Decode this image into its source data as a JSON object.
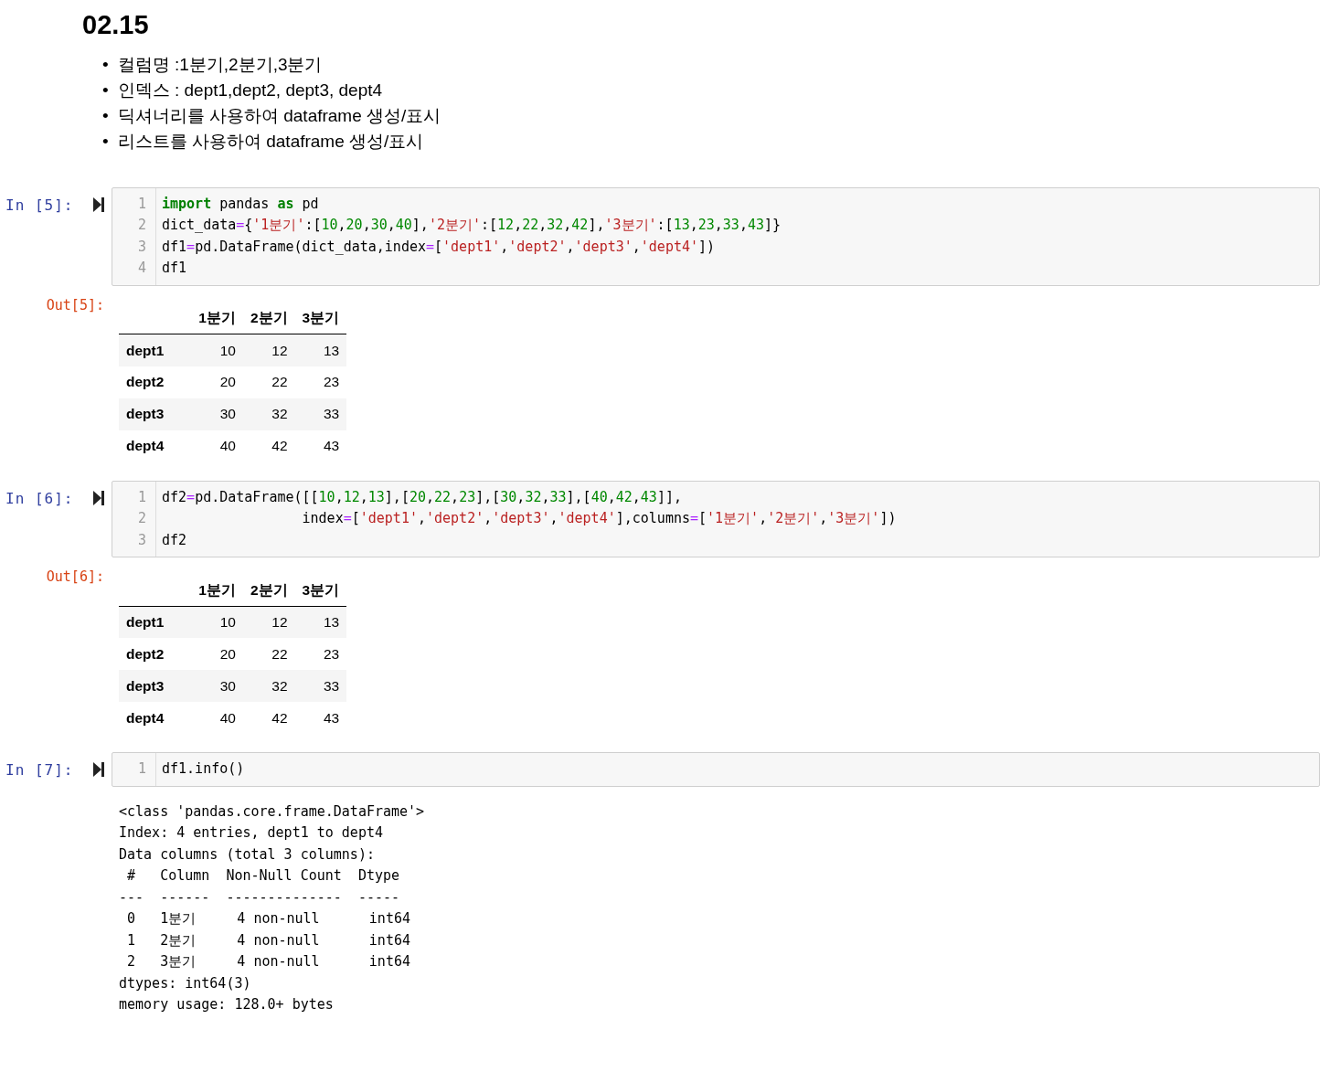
{
  "markdown": {
    "heading": "02.15",
    "bullets": [
      {
        "marker": "•",
        "text": "컬럼명 :1분기,2분기,3분기"
      },
      {
        "marker": "•",
        "text": "인덱스 : dept1,dept2, dept3, dept4"
      },
      {
        "marker": "•",
        "text": "딕셔너리를 사용하여 dataframe 생성/표시"
      },
      {
        "marker": "•",
        "text": "리스트를 사용하여 dataframe 생성/표시"
      }
    ]
  },
  "cells": [
    {
      "prompt": "In [5]:",
      "line_numbers": [
        "1",
        "2",
        "3",
        "4"
      ],
      "lines": [
        [
          {
            "kind": "kw",
            "text": "import"
          },
          {
            "kind": "plain",
            "text": " pandas "
          },
          {
            "kind": "kw",
            "text": "as"
          },
          {
            "kind": "plain",
            "text": " pd"
          }
        ],
        [
          {
            "kind": "plain",
            "text": "dict_data"
          },
          {
            "kind": "op",
            "text": "="
          },
          {
            "kind": "plain",
            "text": "{"
          },
          {
            "kind": "str",
            "text": "'1분기'"
          },
          {
            "kind": "plain",
            "text": ":["
          },
          {
            "kind": "num",
            "text": "10"
          },
          {
            "kind": "plain",
            "text": ","
          },
          {
            "kind": "num",
            "text": "20"
          },
          {
            "kind": "plain",
            "text": ","
          },
          {
            "kind": "num",
            "text": "30"
          },
          {
            "kind": "plain",
            "text": ","
          },
          {
            "kind": "num",
            "text": "40"
          },
          {
            "kind": "plain",
            "text": "],"
          },
          {
            "kind": "str",
            "text": "'2분기'"
          },
          {
            "kind": "plain",
            "text": ":["
          },
          {
            "kind": "num",
            "text": "12"
          },
          {
            "kind": "plain",
            "text": ","
          },
          {
            "kind": "num",
            "text": "22"
          },
          {
            "kind": "plain",
            "text": ","
          },
          {
            "kind": "num",
            "text": "32"
          },
          {
            "kind": "plain",
            "text": ","
          },
          {
            "kind": "num",
            "text": "42"
          },
          {
            "kind": "plain",
            "text": "],"
          },
          {
            "kind": "str",
            "text": "'3분기'"
          },
          {
            "kind": "plain",
            "text": ":["
          },
          {
            "kind": "num",
            "text": "13"
          },
          {
            "kind": "plain",
            "text": ","
          },
          {
            "kind": "num",
            "text": "23"
          },
          {
            "kind": "plain",
            "text": ","
          },
          {
            "kind": "num",
            "text": "33"
          },
          {
            "kind": "plain",
            "text": ","
          },
          {
            "kind": "num",
            "text": "43"
          },
          {
            "kind": "plain",
            "text": "]}"
          }
        ],
        [
          {
            "kind": "plain",
            "text": "df1"
          },
          {
            "kind": "op",
            "text": "="
          },
          {
            "kind": "plain",
            "text": "pd.DataFrame(dict_data,index"
          },
          {
            "kind": "op",
            "text": "="
          },
          {
            "kind": "plain",
            "text": "["
          },
          {
            "kind": "str",
            "text": "'dept1'"
          },
          {
            "kind": "plain",
            "text": ","
          },
          {
            "kind": "str",
            "text": "'dept2'"
          },
          {
            "kind": "plain",
            "text": ","
          },
          {
            "kind": "str",
            "text": "'dept3'"
          },
          {
            "kind": "plain",
            "text": ","
          },
          {
            "kind": "str",
            "text": "'dept4'"
          },
          {
            "kind": "plain",
            "text": "])"
          }
        ],
        [
          {
            "kind": "plain",
            "text": "df1"
          }
        ]
      ],
      "output": {
        "prompt": "Out[5]:",
        "kind": "table",
        "columns": [
          "1분기",
          "2분기",
          "3분기"
        ],
        "rows": [
          {
            "index": "dept1",
            "values": [
              "10",
              "12",
              "13"
            ]
          },
          {
            "index": "dept2",
            "values": [
              "20",
              "22",
              "23"
            ]
          },
          {
            "index": "dept3",
            "values": [
              "30",
              "32",
              "33"
            ]
          },
          {
            "index": "dept4",
            "values": [
              "40",
              "42",
              "43"
            ]
          }
        ]
      }
    },
    {
      "prompt": "In [6]:",
      "line_numbers": [
        "1",
        "2",
        "3"
      ],
      "lines": [
        [
          {
            "kind": "plain",
            "text": "df2"
          },
          {
            "kind": "op",
            "text": "="
          },
          {
            "kind": "plain",
            "text": "pd.DataFrame([["
          },
          {
            "kind": "num",
            "text": "10"
          },
          {
            "kind": "plain",
            "text": ","
          },
          {
            "kind": "num",
            "text": "12"
          },
          {
            "kind": "plain",
            "text": ","
          },
          {
            "kind": "num",
            "text": "13"
          },
          {
            "kind": "plain",
            "text": "],["
          },
          {
            "kind": "num",
            "text": "20"
          },
          {
            "kind": "plain",
            "text": ","
          },
          {
            "kind": "num",
            "text": "22"
          },
          {
            "kind": "plain",
            "text": ","
          },
          {
            "kind": "num",
            "text": "23"
          },
          {
            "kind": "plain",
            "text": "],["
          },
          {
            "kind": "num",
            "text": "30"
          },
          {
            "kind": "plain",
            "text": ","
          },
          {
            "kind": "num",
            "text": "32"
          },
          {
            "kind": "plain",
            "text": ","
          },
          {
            "kind": "num",
            "text": "33"
          },
          {
            "kind": "plain",
            "text": "],["
          },
          {
            "kind": "num",
            "text": "40"
          },
          {
            "kind": "plain",
            "text": ","
          },
          {
            "kind": "num",
            "text": "42"
          },
          {
            "kind": "plain",
            "text": ","
          },
          {
            "kind": "num",
            "text": "43"
          },
          {
            "kind": "plain",
            "text": "]],"
          }
        ],
        [
          {
            "kind": "plain",
            "text": "                 index"
          },
          {
            "kind": "op",
            "text": "="
          },
          {
            "kind": "plain",
            "text": "["
          },
          {
            "kind": "str",
            "text": "'dept1'"
          },
          {
            "kind": "plain",
            "text": ","
          },
          {
            "kind": "str",
            "text": "'dept2'"
          },
          {
            "kind": "plain",
            "text": ","
          },
          {
            "kind": "str",
            "text": "'dept3'"
          },
          {
            "kind": "plain",
            "text": ","
          },
          {
            "kind": "str",
            "text": "'dept4'"
          },
          {
            "kind": "plain",
            "text": "],columns"
          },
          {
            "kind": "op",
            "text": "="
          },
          {
            "kind": "plain",
            "text": "["
          },
          {
            "kind": "str",
            "text": "'1분기'"
          },
          {
            "kind": "plain",
            "text": ","
          },
          {
            "kind": "str",
            "text": "'2분기'"
          },
          {
            "kind": "plain",
            "text": ","
          },
          {
            "kind": "str",
            "text": "'3분기'"
          },
          {
            "kind": "plain",
            "text": "])"
          }
        ],
        [
          {
            "kind": "plain",
            "text": "df2"
          }
        ]
      ],
      "output": {
        "prompt": "Out[6]:",
        "kind": "table",
        "columns": [
          "1분기",
          "2분기",
          "3분기"
        ],
        "rows": [
          {
            "index": "dept1",
            "values": [
              "10",
              "12",
              "13"
            ]
          },
          {
            "index": "dept2",
            "values": [
              "20",
              "22",
              "23"
            ]
          },
          {
            "index": "dept3",
            "values": [
              "30",
              "32",
              "33"
            ]
          },
          {
            "index": "dept4",
            "values": [
              "40",
              "42",
              "43"
            ]
          }
        ]
      }
    },
    {
      "prompt": "In [7]:",
      "line_numbers": [
        "1"
      ],
      "lines": [
        [
          {
            "kind": "plain",
            "text": "df1.info()"
          }
        ]
      ],
      "output": {
        "kind": "stream",
        "lines": [
          "<class 'pandas.core.frame.DataFrame'>",
          "Index: 4 entries, dept1 to dept4",
          "Data columns (total 3 columns):",
          " #   Column  Non-Null Count  Dtype",
          "---  ------  --------------  -----",
          " 0   1분기     4 non-null      int64",
          " 1   2분기     4 non-null      int64",
          " 2   3분기     4 non-null      int64",
          "dtypes: int64(3)",
          "memory usage: 128.0+ bytes"
        ]
      }
    }
  ]
}
